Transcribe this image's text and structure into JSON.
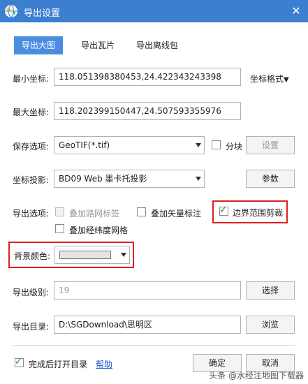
{
  "window": {
    "title": "导出设置",
    "close_glyph": "✕",
    "icon": "globe-icon"
  },
  "tabs": [
    {
      "label": "导出大图",
      "active": true
    },
    {
      "label": "导出瓦片",
      "active": false
    },
    {
      "label": "导出离线包",
      "active": false
    }
  ],
  "min_coord": {
    "label": "最小坐标:",
    "value": "118.051398380453,24.422343243398"
  },
  "coord_format": {
    "label": "坐标格式",
    "arrow": "▼"
  },
  "max_coord": {
    "label": "最大坐标:",
    "value": "118.202399150447,24.507593355976"
  },
  "save_option": {
    "label": "保存选项:",
    "selected": "GeoTIF(*.tif)",
    "tile_label": "分块",
    "tile_checked": false,
    "settings_label": "设置"
  },
  "projection": {
    "label": "坐标投影:",
    "selected": "BD09 Web 墨卡托投影",
    "params_label": "参数"
  },
  "export_options": {
    "label": "导出选项:",
    "road_labels": {
      "label": "叠加路网标签",
      "checked": false,
      "disabled": true
    },
    "vector_labels": {
      "label": "叠加矢量标注",
      "checked": false
    },
    "boundary_clip": {
      "label": "边界范围剪裁",
      "checked": true
    },
    "graticule": {
      "label": "叠加经纬度网格",
      "checked": false
    }
  },
  "background": {
    "label": "背景颜色:"
  },
  "export_level": {
    "label": "导出级别:",
    "value": "19",
    "select_label": "选择"
  },
  "export_dir": {
    "label": "导出目录:",
    "value": "D:\\SGDownload\\思明区",
    "browse_label": "浏览"
  },
  "footer": {
    "open_dir_label": "完成后打开目录",
    "open_dir_checked": true,
    "help_label": "帮助",
    "ok_label": "确定",
    "cancel_label": "取消"
  },
  "watermark": "头条 @水经注地图下载器",
  "colors": {
    "titlebar": "#3c7ed0",
    "tab_active": "#4a8de0",
    "highlight": "#e02020",
    "link": "#1a56c8"
  }
}
